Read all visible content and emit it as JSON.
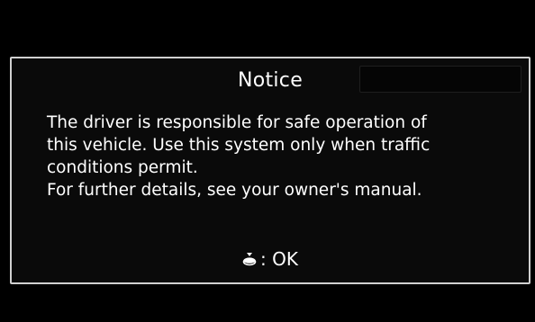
{
  "dialog": {
    "title": "Notice",
    "message_lines": [
      "The driver is responsible for safe operation of",
      "this vehicle. Use this system only when traffic",
      "conditions permit.",
      "For further details, see your owner's manual."
    ],
    "action": {
      "icon": "interface-dial-press-icon",
      "label": ": OK"
    }
  },
  "colors": {
    "screen_background": "#000000",
    "dialog_border": "#d0d0d0",
    "text": "#ffffff"
  }
}
